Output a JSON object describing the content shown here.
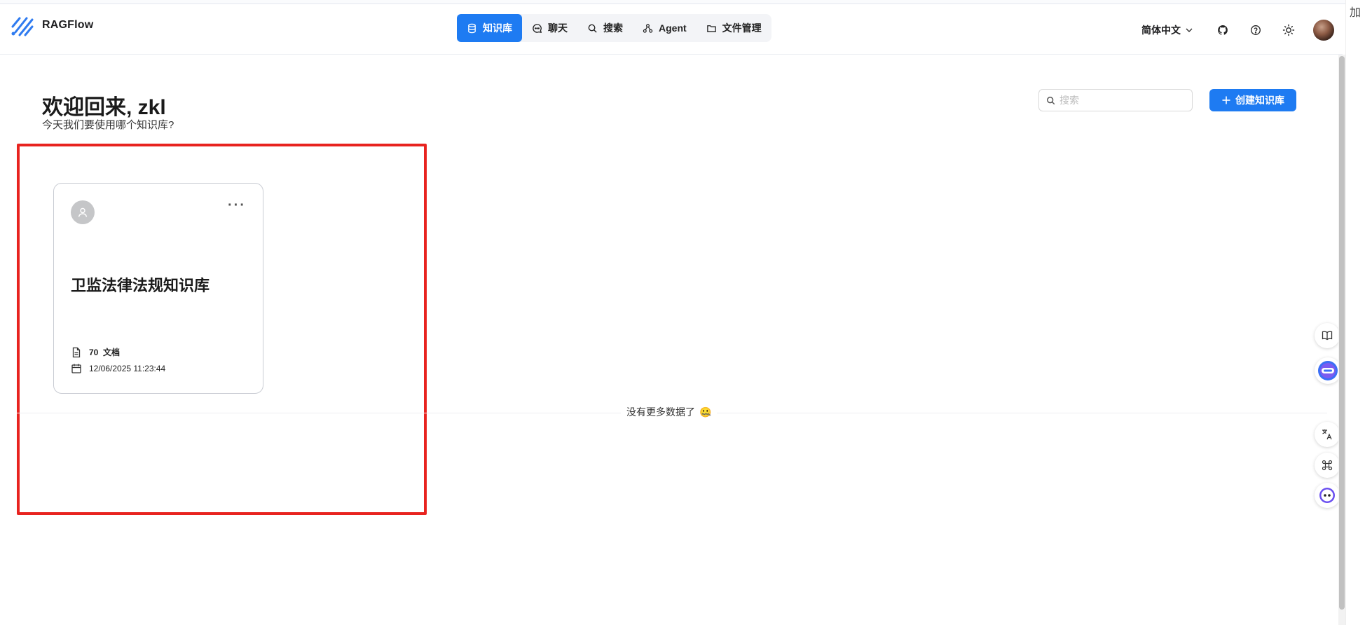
{
  "app": {
    "name": "RAGFlow",
    "accent": "#1e7bf2"
  },
  "nav": {
    "items": [
      {
        "label": "知识库",
        "icon": "database-icon",
        "active": true
      },
      {
        "label": "聊天",
        "icon": "chat-icon",
        "active": false
      },
      {
        "label": "搜索",
        "icon": "search-icon",
        "active": false
      },
      {
        "label": "Agent",
        "icon": "agent-graph-icon",
        "active": false
      },
      {
        "label": "文件管理",
        "icon": "folder-icon",
        "active": false
      }
    ]
  },
  "header": {
    "language": "简体中文",
    "icons": [
      "github-icon",
      "help-icon",
      "theme-sun-icon"
    ]
  },
  "main": {
    "welcome": "欢迎回来, zkl",
    "subtitle": "今天我们要使用哪个知识库?",
    "search_placeholder": "搜索",
    "create_label": "创建知识库",
    "no_more": "没有更多数据了",
    "no_more_emoji": "🤐"
  },
  "cards": [
    {
      "title": "卫监法律法规知识库",
      "doc_count": "70",
      "doc_label": "文档",
      "date": "12/06/2025 11:23:44"
    }
  ],
  "edge": {
    "text": "加"
  },
  "highlight_color": "#e8231f"
}
